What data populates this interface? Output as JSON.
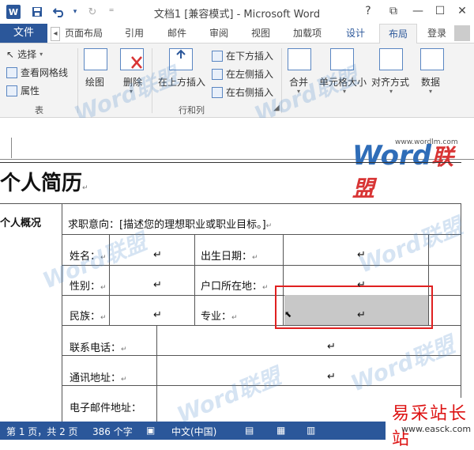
{
  "window": {
    "title": "文档1 [兼容模式] - Microsoft Word",
    "help": "?",
    "restore": "⧉",
    "minimize": "—",
    "maximize": "☐",
    "close": "✕"
  },
  "qat": {
    "save_icon": "save-icon",
    "undo_icon": "undo-icon",
    "redo_icon": "redo-icon",
    "customize": "⁼"
  },
  "tabs": {
    "file": "文件",
    "scroll_left": "◂",
    "items": [
      "页面布局",
      "引用",
      "邮件",
      "审阅",
      "视图",
      "加载项",
      "设计",
      "布局"
    ],
    "login": "登录"
  },
  "ribbon": {
    "table_group": {
      "select": "选择",
      "view_gridlines": "查看网格线",
      "properties": "属性",
      "label": "表"
    },
    "draw_group": {
      "draw": "绘图",
      "delete": "删除"
    },
    "rows_cols_group": {
      "insert_above": "在上方插入",
      "insert_below": "在下方插入",
      "insert_left": "在左侧插入",
      "insert_right": "在右侧插入",
      "label": "行和列"
    },
    "merge": "合并",
    "cell_size": "单元格大小",
    "alignment": "对齐方式",
    "data": "数据"
  },
  "document": {
    "title": "个人简历",
    "section": "个人概况",
    "objective": "求职意向：[描述您的理想职业或职业目标。]",
    "fields": {
      "name": "姓名：",
      "birth": "出生日期：",
      "gender": "性别：",
      "hukou": "户口所在地：",
      "ethnic": "民族：",
      "major": "专业：",
      "phone": "联系电话：",
      "address": "通讯地址：",
      "email": "电子邮件地址："
    },
    "para_mark": "↵"
  },
  "watermark": {
    "brand": "Word",
    "brand_cn": "联盟",
    "url": "www.wordlm.com"
  },
  "status": {
    "page": "第 1 页，共 2 页",
    "words": "386 个字",
    "lang": "中文(中国)"
  },
  "corner_logo": {
    "cn": "易采站长站",
    "en": "www.easck.com"
  },
  "colors": {
    "accent": "#2b579a",
    "selection": "#c8c8c8",
    "highlight": "#e02020"
  }
}
